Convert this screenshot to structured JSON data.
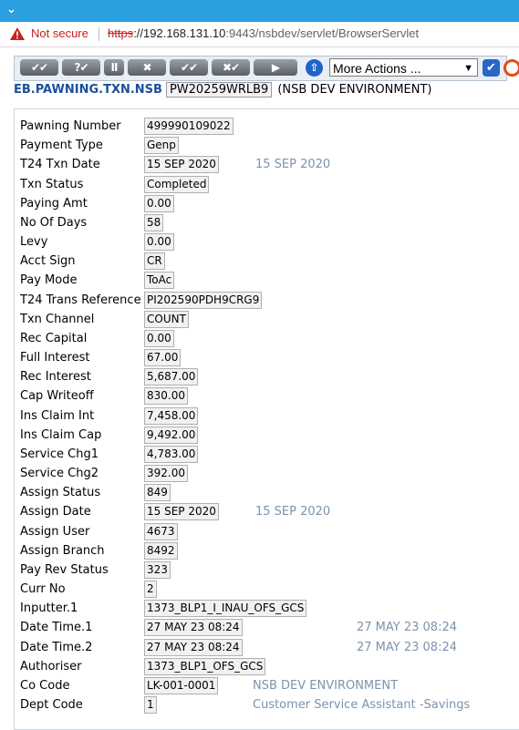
{
  "browser": {
    "not_secure": "Not secure",
    "url_scheme": "https",
    "url_host": "://192.168.131.10",
    "url_rest": ":9443/nsbdev/servlet/BrowserServlet"
  },
  "toolbar": {
    "buttons": [
      "✔✔",
      "?✔",
      "II",
      "✖",
      "✔✔",
      "✖✔",
      "▶"
    ],
    "more_actions": "More Actions ..."
  },
  "header": {
    "app_name": "EB.PAWNING.TXN.NSB",
    "record_id": "PW20259WRLB9",
    "environment": "(NSB DEV ENVIRONMENT)"
  },
  "fields": [
    {
      "label": "Pawning Number",
      "value": "499990109022",
      "enrichment": ""
    },
    {
      "label": "Payment Type",
      "value": "Genp",
      "enrichment": ""
    },
    {
      "label": "T24 Txn Date",
      "value": "15 SEP 2020",
      "enrichment": "15 SEP 2020"
    },
    {
      "label": "Txn Status",
      "value": "Completed",
      "enrichment": ""
    },
    {
      "label": "Paying Amt",
      "value": "0.00",
      "enrichment": ""
    },
    {
      "label": "No Of Days",
      "value": "58",
      "enrichment": ""
    },
    {
      "label": "Levy",
      "value": "0.00",
      "enrichment": ""
    },
    {
      "label": "Acct Sign",
      "value": "CR",
      "enrichment": ""
    },
    {
      "label": "Pay Mode",
      "value": "ToAc",
      "enrichment": ""
    },
    {
      "label": "T24 Trans Reference",
      "value": "PI202590PDH9CRG9",
      "enrichment": ""
    },
    {
      "label": "Txn Channel",
      "value": "COUNT",
      "enrichment": ""
    },
    {
      "label": "Rec Capital",
      "value": "0.00",
      "enrichment": ""
    },
    {
      "label": "Full Interest",
      "value": "67.00",
      "enrichment": ""
    },
    {
      "label": "Rec Interest",
      "value": "5,687.00",
      "enrichment": ""
    },
    {
      "label": "Cap Writeoff",
      "value": "830.00",
      "enrichment": ""
    },
    {
      "label": "Ins Claim Int",
      "value": "7,458.00",
      "enrichment": ""
    },
    {
      "label": "Ins Claim Cap",
      "value": "9,492.00",
      "enrichment": ""
    },
    {
      "label": "Service Chg1",
      "value": "4,783.00",
      "enrichment": ""
    },
    {
      "label": "Service Chg2",
      "value": "392.00",
      "enrichment": ""
    },
    {
      "label": "Assign Status",
      "value": "849",
      "enrichment": ""
    },
    {
      "label": "Assign Date",
      "value": "15 SEP 2020",
      "enrichment": "15 SEP 2020"
    },
    {
      "label": "Assign User",
      "value": "4673",
      "enrichment": ""
    },
    {
      "label": "Assign Branch",
      "value": "8492",
      "enrichment": ""
    },
    {
      "label": "Pay Rev Status",
      "value": "323",
      "enrichment": ""
    },
    {
      "label": "Curr No",
      "value": "2",
      "enrichment": ""
    },
    {
      "label": "Inputter.1",
      "value": "1373_BLP1_I_INAU_OFS_GCS",
      "enrichment": ""
    },
    {
      "label": "Date Time.1",
      "value": "27 MAY 23 08:24",
      "enrichment": "27 MAY 23 08:24"
    },
    {
      "label": "Date Time.2",
      "value": "27 MAY 23 08:24",
      "enrichment": "27 MAY 23 08:24"
    },
    {
      "label": "Authoriser",
      "value": "1373_BLP1_OFS_GCS",
      "enrichment": ""
    },
    {
      "label": "Co Code",
      "value": "LK-001-0001",
      "enrichment": "NSB DEV ENVIRONMENT"
    },
    {
      "label": "Dept Code",
      "value": "1",
      "enrichment": "Customer Service Assistant -Savings"
    }
  ]
}
